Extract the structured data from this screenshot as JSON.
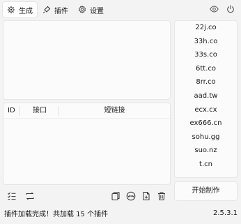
{
  "tabs": [
    {
      "label": "生成",
      "icon": "gear-spark-icon",
      "active": true
    },
    {
      "label": "插件",
      "icon": "plug-icon",
      "active": false
    },
    {
      "label": "设置",
      "icon": "settings-icon",
      "active": false
    }
  ],
  "topright": {
    "view_icon": "eye-icon",
    "power_icon": "power-icon"
  },
  "table": {
    "columns": [
      "ID",
      "接口",
      "短链接"
    ],
    "rows": []
  },
  "domains": [
    "22j.co",
    "33h.co",
    "33s.co",
    "6tt.co",
    "8rr.co",
    "aad.tw",
    "ecx.cx",
    "ex666.cn",
    "sohu.gg",
    "suo.nz",
    "t.cn"
  ],
  "start_button": "开始制作",
  "status": {
    "message": "插件加载完成！共加载 15 个插件",
    "version": "2.5.3.1"
  }
}
